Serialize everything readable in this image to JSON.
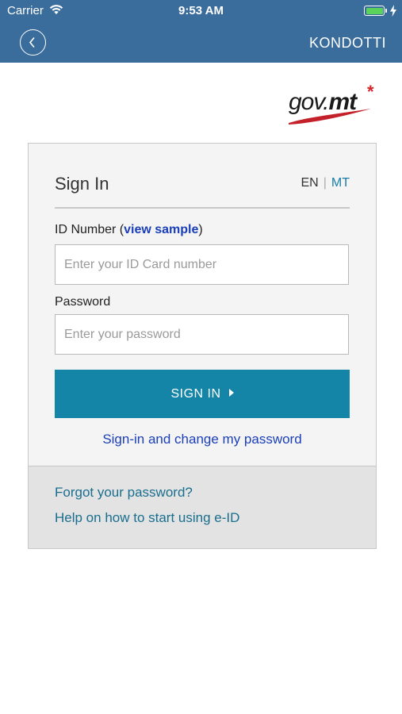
{
  "status_bar": {
    "carrier": "Carrier",
    "time": "9:53 AM",
    "icons": [
      "wifi-icon",
      "battery-icon",
      "charging-bolt-icon"
    ]
  },
  "nav": {
    "back_icon": "chevron-left-icon",
    "title": "KONDOTTI"
  },
  "logo": {
    "text_gov": "gov.",
    "text_mt": "mt",
    "star": "*"
  },
  "signin": {
    "title": "Sign In",
    "lang_en": "EN",
    "lang_sep": "|",
    "lang_mt": "MT",
    "id_label": "ID Number (",
    "id_link": "view sample",
    "id_label_close": ")",
    "id_placeholder": "Enter your ID Card number",
    "id_value": "",
    "pw_label": "Password",
    "pw_placeholder": "Enter your password",
    "pw_value": "",
    "button_label": "SIGN IN",
    "change_pw_link": "Sign-in and change my password"
  },
  "footer": {
    "forgot": "Forgot your password?",
    "help": "Help on how to start using e-ID"
  },
  "colors": {
    "nav_bg": "#3a6d9c",
    "button_bg": "#1484a7",
    "link_blue": "#1a3fb8",
    "logo_red": "#d5232a"
  }
}
